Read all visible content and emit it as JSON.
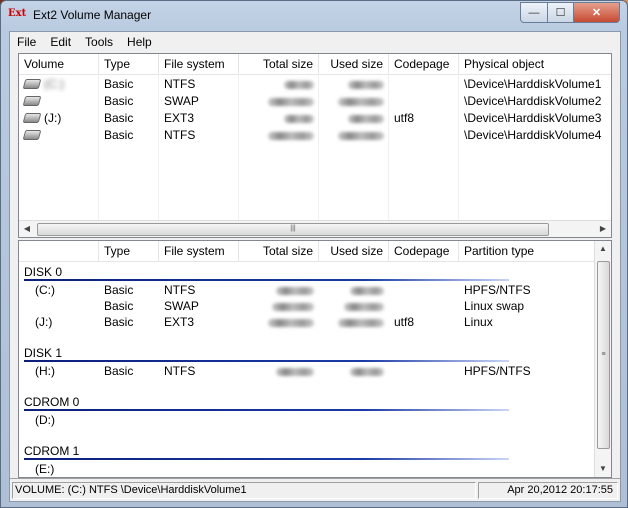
{
  "window": {
    "title": "Ext2 Volume Manager",
    "icon_text": "Ext"
  },
  "menu": [
    "File",
    "Edit",
    "Tools",
    "Help"
  ],
  "volumes": {
    "columns": [
      "Volume",
      "Type",
      "File system",
      "Total size",
      "Used size",
      "Codepage",
      "Physical object"
    ],
    "rows": [
      {
        "volume": "(C:)",
        "type": "Basic",
        "fs": "NTFS",
        "codepage": "",
        "physical": "\\Device\\HarddiskVolume1",
        "volume_redacted": true,
        "total_redacted": true,
        "used_redacted": true
      },
      {
        "volume": "",
        "type": "Basic",
        "fs": "SWAP",
        "codepage": "",
        "physical": "\\Device\\HarddiskVolume2",
        "volume_redacted": false,
        "total_redacted": true,
        "used_redacted": true
      },
      {
        "volume": "(J:)",
        "type": "Basic",
        "fs": "EXT3",
        "codepage": "utf8",
        "physical": "\\Device\\HarddiskVolume3",
        "volume_redacted": false,
        "total_redacted": true,
        "used_redacted": true
      },
      {
        "volume": "",
        "type": "Basic",
        "fs": "NTFS",
        "codepage": "",
        "physical": "\\Device\\HarddiskVolume4",
        "volume_redacted": true,
        "total_redacted": true,
        "used_redacted": true
      }
    ]
  },
  "disks": {
    "columns": [
      "",
      "Type",
      "File system",
      "Total size",
      "Used size",
      "Codepage",
      "Partition type"
    ],
    "groups": [
      {
        "name": "DISK 0",
        "parts": [
          {
            "volume": "(C:)",
            "type": "Basic",
            "fs": "NTFS",
            "codepage": "",
            "ptype": "HPFS/NTFS"
          },
          {
            "volume": "",
            "type": "Basic",
            "fs": "SWAP",
            "codepage": "",
            "ptype": "Linux swap"
          },
          {
            "volume": "(J:)",
            "type": "Basic",
            "fs": "EXT3",
            "codepage": "utf8",
            "ptype": "Linux"
          }
        ]
      },
      {
        "name": "DISK 1",
        "parts": [
          {
            "volume": "(H:)",
            "type": "Basic",
            "fs": "NTFS",
            "codepage": "",
            "ptype": "HPFS/NTFS"
          }
        ]
      },
      {
        "name": "CDROM 0",
        "parts": [
          {
            "volume": "(D:)",
            "type": "",
            "fs": "",
            "codepage": "",
            "ptype": ""
          }
        ]
      },
      {
        "name": "CDROM 1",
        "parts": [
          {
            "volume": "(E:)",
            "type": "",
            "fs": "",
            "codepage": "",
            "ptype": ""
          }
        ]
      }
    ]
  },
  "status": {
    "left": "VOLUME: (C:) NTFS \\Device\\HarddiskVolume1",
    "right": "Apr 20,2012 20:17:55"
  },
  "icons": {
    "minimize": "minimize-icon",
    "maximize": "maximize-icon",
    "close": "close-icon",
    "drive": "hard-drive-icon",
    "scroll_left": "scroll-left-icon",
    "scroll_right": "scroll-right-icon",
    "scroll_up": "scroll-up-icon",
    "scroll_down": "scroll-down-icon"
  }
}
